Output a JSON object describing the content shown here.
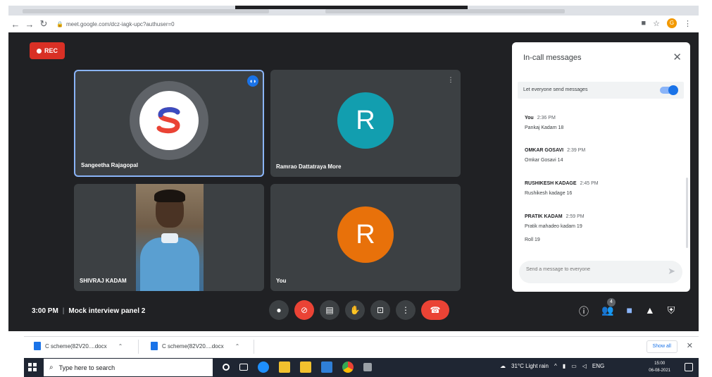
{
  "browser": {
    "url": "meet.google.com/dcz-iagk-upc?authuser=0",
    "profile_initial": "G"
  },
  "meet": {
    "rec_label": "REC",
    "tiles": [
      {
        "name": "Sangeetha Rajagopal",
        "initial": "S"
      },
      {
        "name": "Ramrao Dattatraya More",
        "initial": "R",
        "color": "#129eaf"
      },
      {
        "name": "SHIVRAJ KADAM"
      },
      {
        "name": "You",
        "initial": "R",
        "color": "#e8710a"
      }
    ],
    "time": "3:00 PM",
    "separator": "|",
    "meeting_name": "Mock interview panel 2",
    "people_badge": "4"
  },
  "chat": {
    "title": "In-call messages",
    "toggle_label": "Let everyone send messages",
    "toggle_on": true,
    "messages": [
      {
        "sender": "You",
        "time": "2:36 PM",
        "lines": [
          "Pankaj Kadam 18"
        ]
      },
      {
        "sender": "OMKAR GOSAVI",
        "time": "2:39 PM",
        "lines": [
          "Omkar Gosavi 14"
        ]
      },
      {
        "sender": "RUSHIKESH KADAGE",
        "time": "2:45 PM",
        "lines": [
          "Rushikesh kadage 16"
        ]
      },
      {
        "sender": "PRATIK KADAM",
        "time": "2:59 PM",
        "lines": [
          "Pratik mahadeo kadam 19",
          "Roll 19"
        ]
      }
    ],
    "input_placeholder": "Send a message to everyone"
  },
  "downloads": {
    "items": [
      {
        "label": "C scheme(82V20....docx"
      },
      {
        "label": "C scheme(82V20....docx"
      }
    ],
    "show_all": "Show all"
  },
  "taskbar": {
    "search_placeholder": "Type here to search",
    "weather": "31°C  Light rain",
    "lang": "ENG",
    "time": "15:00",
    "date": "06-08-2021"
  }
}
